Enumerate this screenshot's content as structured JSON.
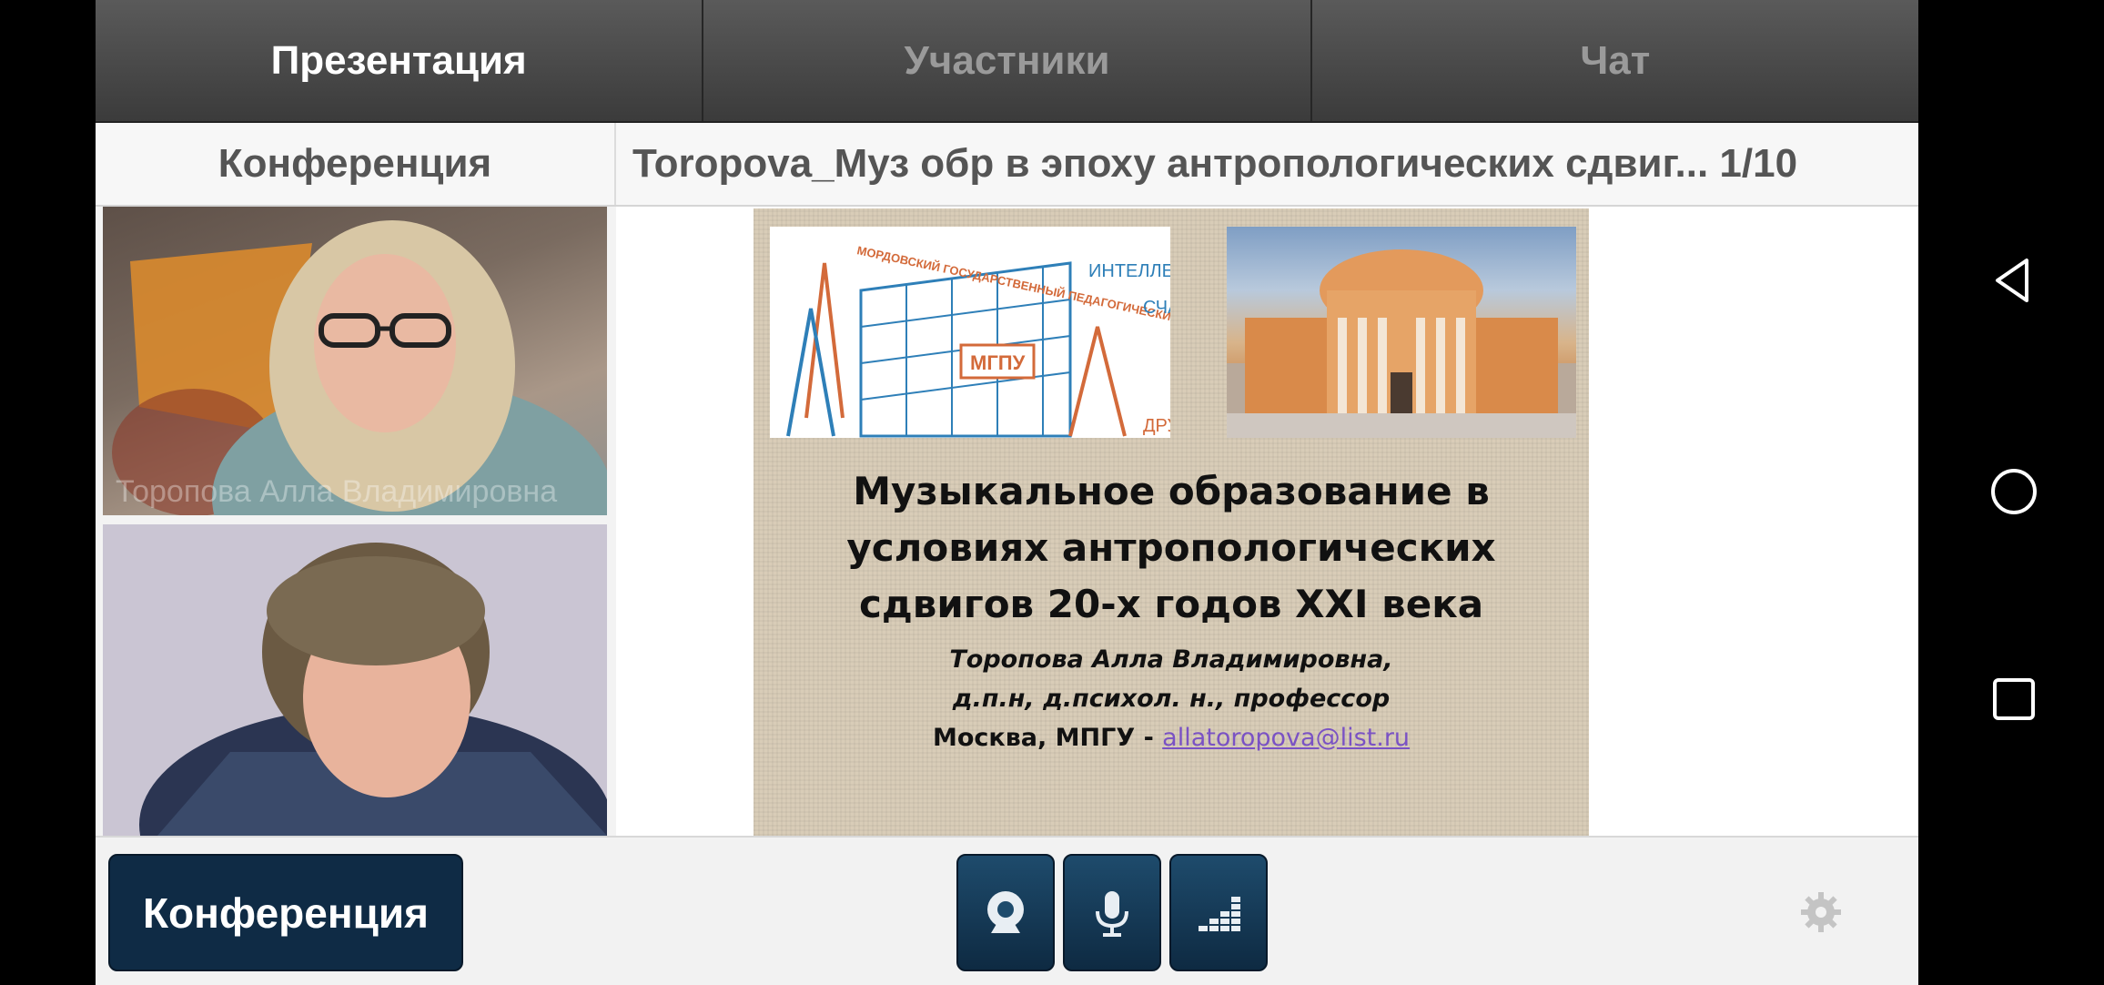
{
  "tabs": [
    {
      "label": "Презентация",
      "active": true
    },
    {
      "label": "Участники",
      "active": false
    },
    {
      "label": "Чат",
      "active": false
    }
  ],
  "subheader": {
    "left_label": "Конференция",
    "presentation_title": "Toropova_Муз обр в эпоху антропологических сдвиг... 1/10"
  },
  "videos": [
    {
      "name": "Торопова Алла Владимировна"
    },
    {
      "name": ""
    }
  ],
  "slide": {
    "title_lines": [
      "Музыкальное образование в",
      "условиях антропологических",
      "сдвигов 20-х годов XXI века"
    ],
    "author": "Торопова Алла Владимировна,",
    "degree": "д.п.н, д.психол. н., профессор",
    "place": "Москва, МПГУ - ",
    "email": "allatoropova@list.ru",
    "image1_caption": "МОРДОВСКИЙ ГОСУДАРСТВЕННЫЙ ПЕДАГОГИЧЕСКИЙ УНИВЕРСИТЕТ",
    "image1_badge": "МГПУ",
    "image1_side_text": "ИНТЕЛЛЕКТ",
    "image1_side_text2": "СЧА",
    "image1_side_text3": "ДРУ"
  },
  "bottombar": {
    "conference_button": "Конференция",
    "camera_icon": "webcam-icon",
    "mic_icon": "microphone-icon",
    "levels_icon": "audio-level-icon",
    "settings_icon": "gear-icon"
  },
  "colors": {
    "accent": "#0f2b45",
    "tab_bg": "#4a4a4a",
    "slide_bg": "#d9cdb8",
    "link": "#7a52c4"
  }
}
